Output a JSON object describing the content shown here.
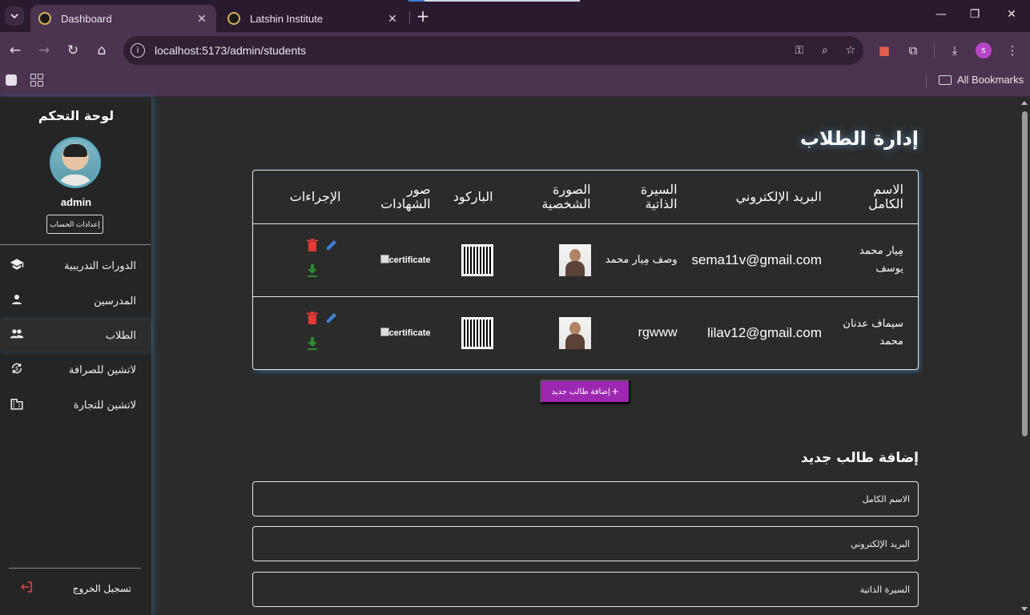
{
  "browser": {
    "tabs": [
      {
        "title": "Dashboard",
        "active": true
      },
      {
        "title": "Latshin Institute",
        "active": false
      }
    ],
    "url": "localhost:5173/admin/students",
    "profile_initial": "s",
    "bookmarks_label": "All Bookmarks"
  },
  "sidebar": {
    "title": "لوحة التحكم",
    "username": "admin",
    "settings_label": "إعدادات الحساب",
    "items": [
      {
        "label": "الدورات التدريبية",
        "icon": "school-icon"
      },
      {
        "label": "المدرسين",
        "icon": "person-icon"
      },
      {
        "label": "الطلاب",
        "icon": "people-icon",
        "active": true
      },
      {
        "label": "لاتشين للصرافة",
        "icon": "currency-exchange-icon"
      },
      {
        "label": "لاتشين للتجارة",
        "icon": "business-icon"
      }
    ],
    "logout_label": "تسجيل الخروج"
  },
  "main": {
    "title": "إدارة الطلاب",
    "table": {
      "headers": [
        "الاسم الكامل",
        "البريد الإلكتروني",
        "السيرة الذاتية",
        "الصورة الشخصية",
        "الباركود",
        "صور الشهادات",
        "الإجراءات"
      ],
      "rows": [
        {
          "name": "مِيار محمد يوسف",
          "email": "sema11v@gmail.com",
          "bio": "وصف مِيار محمد",
          "certificate_alt": "certificate"
        },
        {
          "name": "سيماف عدنان محمد",
          "email": "lilav12@gmail.com",
          "bio": "rgwww",
          "certificate_alt": "certificate"
        }
      ]
    },
    "add_button_label": "إضافة طالب جديد",
    "form": {
      "title": "إضافة طالب جديد",
      "fields": {
        "full_name": "الاسم الكامل",
        "email": "البريد الإلكتروني",
        "bio": "السيرة الذاتية"
      }
    }
  },
  "colors": {
    "accent_purple": "#9c27b0",
    "delete_red": "#e53935",
    "edit_blue": "#3f7fd6",
    "download_green": "#2e8b2e"
  }
}
